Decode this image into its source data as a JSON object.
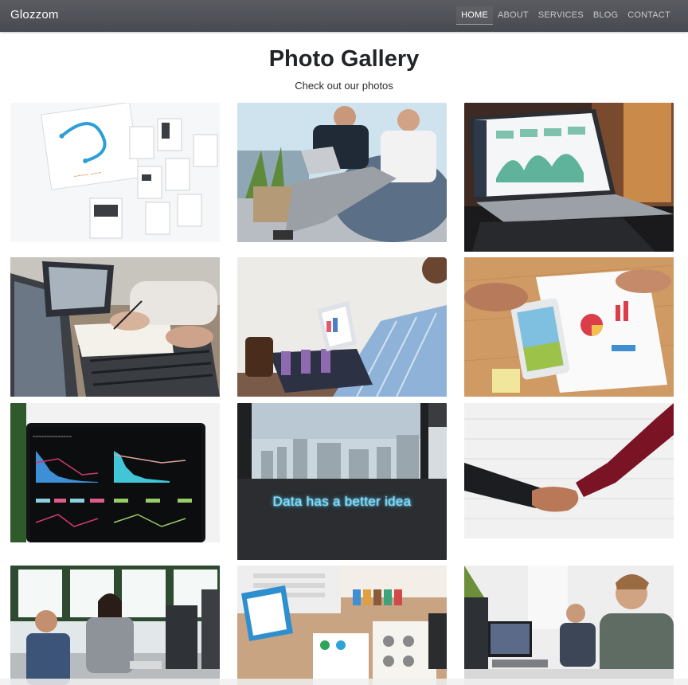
{
  "navbar": {
    "brand": "Glozzom",
    "items": [
      {
        "label": "HOME",
        "active": true
      },
      {
        "label": "ABOUT"
      },
      {
        "label": "SERVICES"
      },
      {
        "label": "BLOG"
      },
      {
        "label": "CONTACT"
      }
    ]
  },
  "gallery": {
    "title": "Photo Gallery",
    "subtitle": "Check out our photos",
    "neon_sign": "Data has a better idea"
  }
}
